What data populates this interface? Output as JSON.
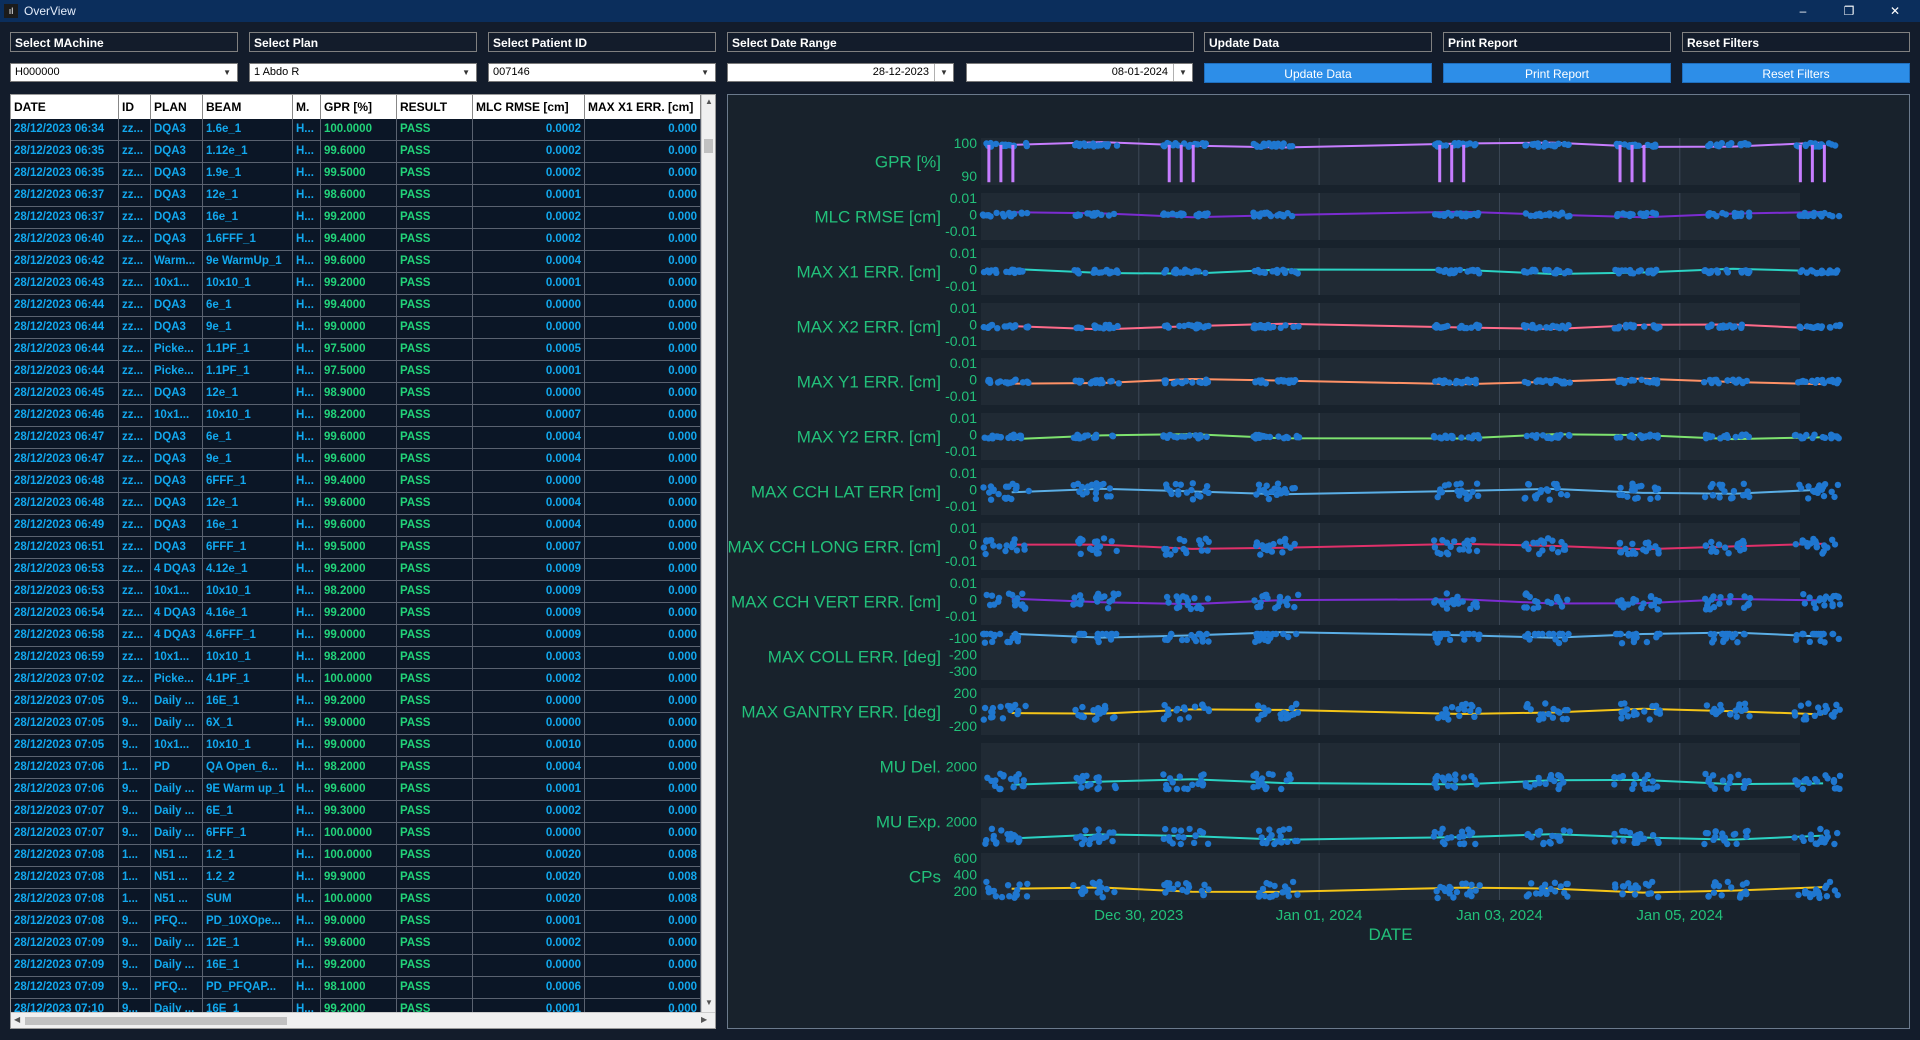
{
  "window": {
    "title": "OverView",
    "minimize": "–",
    "restore": "❐",
    "close": "✕"
  },
  "filters": {
    "machine": {
      "label": "Select MAchine",
      "value": "H000000"
    },
    "plan": {
      "label": "Select Plan",
      "value": "1 Abdo R"
    },
    "patient": {
      "label": "Select Patient ID",
      "value": "007146"
    },
    "date_range": {
      "label": "Select Date Range",
      "from": "28-12-2023",
      "to": "08-01-2024"
    },
    "update": {
      "label": "Update Data",
      "button": "Update Data"
    },
    "print": {
      "label": "Print Report",
      "button": "Print Report"
    },
    "reset": {
      "label": "Reset Filters",
      "button": "Reset Filters"
    }
  },
  "table": {
    "columns": [
      "DATE",
      "ID",
      "PLAN",
      "BEAM",
      "M.",
      "GPR [%]",
      "RESULT",
      "MLC RMSE [cm]",
      "MAX X1 ERR. [cm]"
    ],
    "rows": [
      [
        "28/12/2023 06:34",
        "zz...",
        "DQA3",
        "1.6e_1",
        "H...",
        "100.0000",
        "PASS",
        "0.0002",
        "0.000"
      ],
      [
        "28/12/2023 06:35",
        "zz...",
        "DQA3",
        "1.12e_1",
        "H...",
        "99.6000",
        "PASS",
        "0.0002",
        "0.000"
      ],
      [
        "28/12/2023 06:35",
        "zz...",
        "DQA3",
        "1.9e_1",
        "H...",
        "99.5000",
        "PASS",
        "0.0002",
        "0.000"
      ],
      [
        "28/12/2023 06:37",
        "zz...",
        "DQA3",
        "12e_1",
        "H...",
        "98.6000",
        "PASS",
        "0.0001",
        "0.000"
      ],
      [
        "28/12/2023 06:37",
        "zz...",
        "DQA3",
        "16e_1",
        "H...",
        "99.2000",
        "PASS",
        "0.0002",
        "0.000"
      ],
      [
        "28/12/2023 06:40",
        "zz...",
        "DQA3",
        "1.6FFF_1",
        "H...",
        "99.4000",
        "PASS",
        "0.0002",
        "0.000"
      ],
      [
        "28/12/2023 06:42",
        "zz...",
        "Warm...",
        "9e WarmUp_1",
        "H...",
        "99.6000",
        "PASS",
        "0.0004",
        "0.000"
      ],
      [
        "28/12/2023 06:43",
        "zz...",
        "10x1...",
        "10x10_1",
        "H...",
        "99.2000",
        "PASS",
        "0.0001",
        "0.000"
      ],
      [
        "28/12/2023 06:44",
        "zz...",
        "DQA3",
        "6e_1",
        "H...",
        "99.4000",
        "PASS",
        "0.0000",
        "0.000"
      ],
      [
        "28/12/2023 06:44",
        "zz...",
        "DQA3",
        "9e_1",
        "H...",
        "99.0000",
        "PASS",
        "0.0000",
        "0.000"
      ],
      [
        "28/12/2023 06:44",
        "zz...",
        "Picke...",
        "1.1PF_1",
        "H...",
        "97.5000",
        "PASS",
        "0.0005",
        "0.000"
      ],
      [
        "28/12/2023 06:44",
        "zz...",
        "Picke...",
        "1.1PF_1",
        "H...",
        "97.5000",
        "PASS",
        "0.0001",
        "0.000"
      ],
      [
        "28/12/2023 06:45",
        "zz...",
        "DQA3",
        "12e_1",
        "H...",
        "98.9000",
        "PASS",
        "0.0000",
        "0.000"
      ],
      [
        "28/12/2023 06:46",
        "zz...",
        "10x1...",
        "10x10_1",
        "H...",
        "98.2000",
        "PASS",
        "0.0007",
        "0.000"
      ],
      [
        "28/12/2023 06:47",
        "zz...",
        "DQA3",
        "6e_1",
        "H...",
        "99.6000",
        "PASS",
        "0.0004",
        "0.000"
      ],
      [
        "28/12/2023 06:47",
        "zz...",
        "DQA3",
        "9e_1",
        "H...",
        "99.6000",
        "PASS",
        "0.0004",
        "0.000"
      ],
      [
        "28/12/2023 06:48",
        "zz...",
        "DQA3",
        "6FFF_1",
        "H...",
        "99.4000",
        "PASS",
        "0.0000",
        "0.000"
      ],
      [
        "28/12/2023 06:48",
        "zz...",
        "DQA3",
        "12e_1",
        "H...",
        "99.6000",
        "PASS",
        "0.0004",
        "0.000"
      ],
      [
        "28/12/2023 06:49",
        "zz...",
        "DQA3",
        "16e_1",
        "H...",
        "99.6000",
        "PASS",
        "0.0004",
        "0.000"
      ],
      [
        "28/12/2023 06:51",
        "zz...",
        "DQA3",
        "6FFF_1",
        "H...",
        "99.5000",
        "PASS",
        "0.0007",
        "0.000"
      ],
      [
        "28/12/2023 06:53",
        "zz...",
        "4 DQA3",
        "4.12e_1",
        "H...",
        "99.2000",
        "PASS",
        "0.0009",
        "0.000"
      ],
      [
        "28/12/2023 06:53",
        "zz...",
        "10x1...",
        "10x10_1",
        "H...",
        "98.2000",
        "PASS",
        "0.0009",
        "0.000"
      ],
      [
        "28/12/2023 06:54",
        "zz...",
        "4 DQA3",
        "4.16e_1",
        "H...",
        "99.2000",
        "PASS",
        "0.0009",
        "0.000"
      ],
      [
        "28/12/2023 06:58",
        "zz...",
        "4 DQA3",
        "4.6FFF_1",
        "H...",
        "99.0000",
        "PASS",
        "0.0009",
        "0.000"
      ],
      [
        "28/12/2023 06:59",
        "zz...",
        "10x1...",
        "10x10_1",
        "H...",
        "98.2000",
        "PASS",
        "0.0003",
        "0.000"
      ],
      [
        "28/12/2023 07:02",
        "zz...",
        "Picke...",
        "4.1PF_1",
        "H...",
        "100.0000",
        "PASS",
        "0.0002",
        "0.000"
      ],
      [
        "28/12/2023 07:05",
        "9...",
        "Daily ...",
        "16E_1",
        "H...",
        "99.2000",
        "PASS",
        "0.0000",
        "0.000"
      ],
      [
        "28/12/2023 07:05",
        "9...",
        "Daily ...",
        "6X_1",
        "H...",
        "99.0000",
        "PASS",
        "0.0000",
        "0.000"
      ],
      [
        "28/12/2023 07:05",
        "9...",
        "10x1...",
        "10x10_1",
        "H...",
        "99.0000",
        "PASS",
        "0.0010",
        "0.000"
      ],
      [
        "28/12/2023 07:06",
        "1...",
        "PD",
        "QA Open_6...",
        "H...",
        "98.2000",
        "PASS",
        "0.0004",
        "0.000"
      ],
      [
        "28/12/2023 07:06",
        "9...",
        "Daily ...",
        "9E Warm up_1",
        "H...",
        "99.6000",
        "PASS",
        "0.0001",
        "0.000"
      ],
      [
        "28/12/2023 07:07",
        "9...",
        "Daily ...",
        "6E_1",
        "H...",
        "99.3000",
        "PASS",
        "0.0002",
        "0.000"
      ],
      [
        "28/12/2023 07:07",
        "9...",
        "Daily ...",
        "6FFF_1",
        "H...",
        "100.0000",
        "PASS",
        "0.0000",
        "0.000"
      ],
      [
        "28/12/2023 07:08",
        "1...",
        "N51 ...",
        "1.2_1",
        "H...",
        "100.0000",
        "PASS",
        "0.0020",
        "0.008"
      ],
      [
        "28/12/2023 07:08",
        "1...",
        "N51 ...",
        "1.2_2",
        "H...",
        "99.9000",
        "PASS",
        "0.0020",
        "0.008"
      ],
      [
        "28/12/2023 07:08",
        "1...",
        "N51 ...",
        "SUM",
        "H...",
        "100.0000",
        "PASS",
        "0.0020",
        "0.008"
      ],
      [
        "28/12/2023 07:08",
        "9...",
        "PFQ...",
        "PD_10XOpe...",
        "H...",
        "99.0000",
        "PASS",
        "0.0001",
        "0.000"
      ],
      [
        "28/12/2023 07:09",
        "9...",
        "Daily ...",
        "12E_1",
        "H...",
        "99.6000",
        "PASS",
        "0.0002",
        "0.000"
      ],
      [
        "28/12/2023 07:09",
        "9...",
        "Daily ...",
        "16E_1",
        "H...",
        "99.2000",
        "PASS",
        "0.0000",
        "0.000"
      ],
      [
        "28/12/2023 07:09",
        "9...",
        "PFQ...",
        "PD_PFQAP...",
        "H...",
        "98.1000",
        "PASS",
        "0.0006",
        "0.000"
      ],
      [
        "28/12/2023 07:10",
        "9...",
        "Daily ...",
        "16E_1",
        "H...",
        "99.2000",
        "PASS",
        "0.0001",
        "0.000"
      ]
    ]
  },
  "chart_data": {
    "type": "scatter",
    "xlabel": "DATE",
    "x_ticks": [
      "Dec 30, 2023",
      "Jan 01, 2024",
      "Jan 03, 2024",
      "Jan 05, 2024"
    ],
    "xlim": [
      "2023-12-28 06:00",
      "2024-01-06 08:00"
    ],
    "grid": true,
    "session_dates": [
      "2023-12-28",
      "2023-12-29",
      "2023-12-30",
      "2023-12-31",
      "2024-01-02",
      "2024-01-03",
      "2024-01-04",
      "2024-01-05",
      "2024-01-06"
    ],
    "panels": [
      {
        "ylabel": "GPR [%]",
        "yticks": [
          "100",
          "90"
        ],
        "ylim": [
          85,
          102
        ],
        "line_color": "#c77dff",
        "point_color": "#1f77d0",
        "base": 99.5,
        "spikes": 86,
        "spike_color": "#c77dff"
      },
      {
        "ylabel": "MLC RMSE [cm]",
        "yticks": [
          "0.01",
          "0",
          "-0.01"
        ],
        "ylim": [
          -0.012,
          0.012
        ],
        "line_color": "#7b2cd1",
        "point_color": "#1f77d0",
        "base": 0.001
      },
      {
        "ylabel": "MAX X1 ERR. [cm]",
        "yticks": [
          "0.01",
          "0",
          "-0.01"
        ],
        "ylim": [
          -0.012,
          0.012
        ],
        "line_color": "#2bd3c4",
        "point_color": "#1f77d0",
        "base": 0
      },
      {
        "ylabel": "MAX X2 ERR. [cm]",
        "yticks": [
          "0.01",
          "0",
          "-0.01"
        ],
        "ylim": [
          -0.012,
          0.012
        ],
        "line_color": "#ff6b8a",
        "point_color": "#1f77d0",
        "base": 0
      },
      {
        "ylabel": "MAX Y1 ERR. [cm]",
        "yticks": [
          "0.01",
          "0",
          "-0.01"
        ],
        "ylim": [
          -0.012,
          0.012
        ],
        "line_color": "#ff9166",
        "point_color": "#1f77d0",
        "base": 0
      },
      {
        "ylabel": "MAX Y2 ERR. [cm]",
        "yticks": [
          "0.01",
          "0",
          "-0.01"
        ],
        "ylim": [
          -0.012,
          0.012
        ],
        "line_color": "#7ee36f",
        "point_color": "#1f77d0",
        "base": 0
      },
      {
        "ylabel": "MAX CCH LAT ERR [cm]",
        "yticks": [
          "0.01",
          "0",
          "-0.01"
        ],
        "ylim": [
          -0.012,
          0.012
        ],
        "line_color": "#5aaee6",
        "point_color": "#1f77d0",
        "base": 0
      },
      {
        "ylabel": "MAX CCH LONG ERR. [cm]",
        "yticks": [
          "0.01",
          "0",
          "-0.01"
        ],
        "ylim": [
          -0.012,
          0.012
        ],
        "line_color": "#e0306a",
        "point_color": "#1f77d0",
        "base": 0
      },
      {
        "ylabel": "MAX CCH VERT ERR. [cm]",
        "yticks": [
          "0.01",
          "0",
          "-0.01"
        ],
        "ylim": [
          -0.012,
          0.012
        ],
        "line_color": "#7b2cd1",
        "point_color": "#1f77d0",
        "base": 0
      },
      {
        "ylabel": "MAX COLL ERR. [deg]",
        "yticks": [
          "-100",
          "-200",
          "-300"
        ],
        "ylim": [
          -320,
          -80
        ],
        "line_color": "#5aaee6",
        "point_color": "#1f77d0",
        "base": -90
      },
      {
        "ylabel": "MAX GANTRY ERR. [deg]",
        "yticks": [
          "200",
          "0",
          "-200"
        ],
        "ylim": [
          -240,
          240
        ],
        "line_color": "#f5c518",
        "point_color": "#1f77d0",
        "base": 0
      },
      {
        "ylabel": "MU Del.",
        "yticks": [
          "2000"
        ],
        "ylim": [
          0,
          3500
        ],
        "line_color": "#2bd3c4",
        "point_color": "#1f77d0",
        "base": 600
      },
      {
        "ylabel": "MU Exp.",
        "yticks": [
          "2000"
        ],
        "ylim": [
          0,
          3500
        ],
        "line_color": "#2bd3c4",
        "point_color": "#1f77d0",
        "base": 600
      },
      {
        "ylabel": "CPs",
        "yticks": [
          "600",
          "400",
          "200"
        ],
        "ylim": [
          0,
          700
        ],
        "line_color": "#f5c518",
        "point_color": "#1f77d0",
        "base": 150
      }
    ]
  },
  "colors": {
    "text_blue": "#12a8ee",
    "text_green": "#22d47a",
    "button_blue": "#2d8ee8",
    "plot_label": "#22c07a",
    "plot_bg": "#18222c",
    "axes_bg": "#202a34"
  }
}
